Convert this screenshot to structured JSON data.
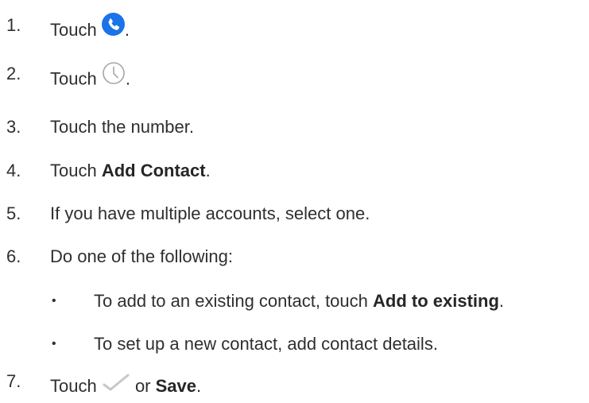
{
  "steps": [
    {
      "num": "1.",
      "text": "Touch ",
      "tail": ".",
      "icon": "phone-app-icon"
    },
    {
      "num": "2.",
      "text": "Touch ",
      "tail": ".",
      "icon": "recents-clock-icon"
    },
    {
      "num": "3.",
      "text": "Touch the number."
    },
    {
      "num": "4.",
      "text": "Touch ",
      "bold": "Add Contact",
      "tail": "."
    },
    {
      "num": "5.",
      "text": "If you have multiple accounts, select one."
    },
    {
      "num": "6.",
      "text": "Do one of the following:"
    },
    {
      "num": "7.",
      "text": "Touch ",
      "middle": " or ",
      "bold": "Save",
      "tail": ".",
      "icon": "checkmark-icon"
    }
  ],
  "substeps": [
    {
      "bullet": "•",
      "text": "To add to an existing contact, touch ",
      "bold": "Add to existing",
      "tail": "."
    },
    {
      "bullet": "•",
      "text": "To set up a new contact, add contact details."
    }
  ],
  "colors": {
    "text": "#2f2f2f",
    "phone_icon_blue": "#1a73e8",
    "clock_gray": "#9e9e9e",
    "check_gray": "#c8c8c8"
  }
}
